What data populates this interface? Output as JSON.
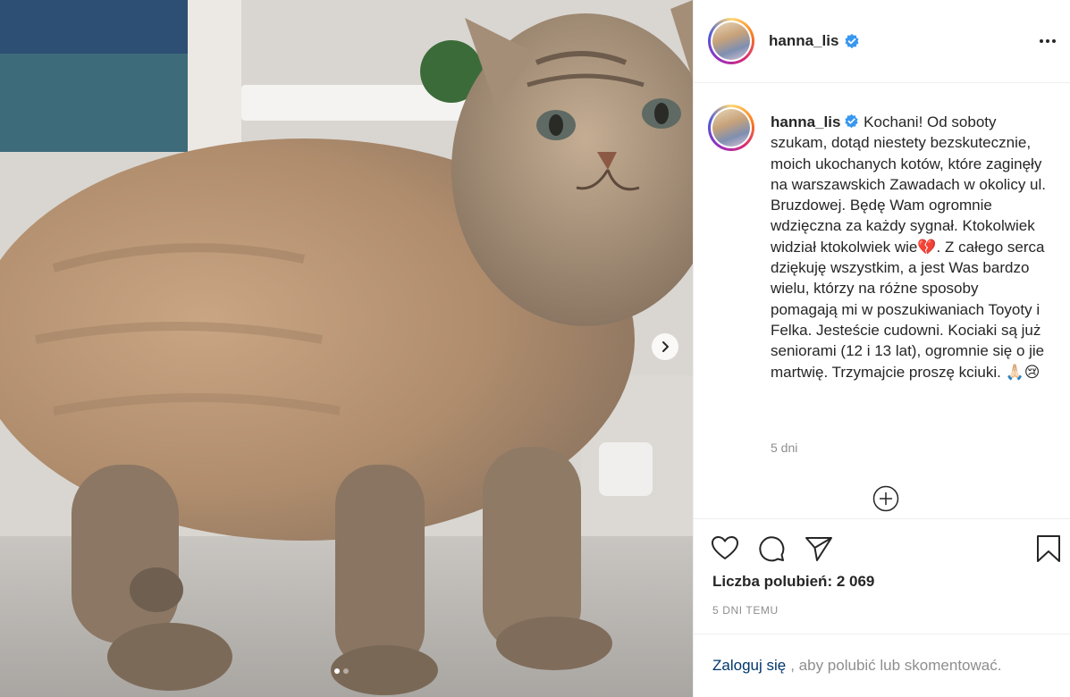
{
  "post": {
    "username": "hanna_lis",
    "verified": true,
    "caption_text": " Kochani! Od soboty szukam, dotąd niestety bezskutecznie, moich ukochanych kotów, które zaginęły na warszawskich Zawadach w okolicy ul. Bruzdowej. Będę Wam ogromnie wdzięczna za każdy sygnał. Ktokolwiek widział ktokolwiek wie💔. Z całego serca dziękuję wszystkim, a jest Was bardzo wielu, którzy na różne sposoby pomagają mi w poszukiwaniach Toyoty i Felka. Jesteście cudowni. Kociaki są już seniorami (12 i 13 lat), ogromnie się o jie martwię. Trzymajcie proszę kciuki. 🙏🏻😢",
    "caption_time": "5 dni",
    "likes": "Liczba polubień: 2 069",
    "timestamp": "5 DNI TEMU",
    "carousel": {
      "total": 2,
      "current": 1
    }
  },
  "login_prompt": {
    "link": "Zaloguj się",
    "text": ", aby polubić lub skomentować."
  },
  "icons": {
    "more": "more-options-icon",
    "next": "chevron-right-icon",
    "like": "heart-icon",
    "comment": "comment-icon",
    "share": "paper-plane-icon",
    "save": "bookmark-icon",
    "load_more": "plus-circle-icon",
    "verified": "verified-badge-icon"
  },
  "colors": {
    "verified": "#3897f0",
    "link": "#00376b",
    "muted": "#8e8e8e",
    "divider": "#efefef"
  }
}
